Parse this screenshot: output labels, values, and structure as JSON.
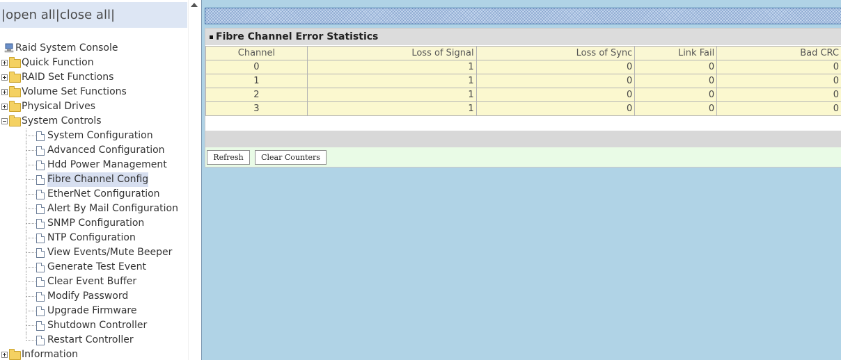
{
  "nav": {
    "open_all": "open all",
    "close_all": "close all",
    "root_label": "Raid System Console",
    "folders": [
      {
        "label": "Quick Function"
      },
      {
        "label": "RAID Set Functions"
      },
      {
        "label": "Volume Set Functions"
      },
      {
        "label": "Physical Drives"
      },
      {
        "label": "System Controls"
      }
    ],
    "system_controls_items": [
      {
        "label": "System Configuration"
      },
      {
        "label": "Advanced Configuration"
      },
      {
        "label": "Hdd Power Management"
      },
      {
        "label": "Fibre Channel Config"
      },
      {
        "label": "EtherNet Configuration"
      },
      {
        "label": "Alert By Mail Configuration"
      },
      {
        "label": "SNMP Configuration"
      },
      {
        "label": "NTP Configuration"
      },
      {
        "label": "View Events/Mute Beeper"
      },
      {
        "label": "Generate Test Event"
      },
      {
        "label": "Clear Event Buffer"
      },
      {
        "label": "Modify Password"
      },
      {
        "label": "Upgrade Firmware"
      },
      {
        "label": "Shutdown Controller"
      },
      {
        "label": "Restart Controller"
      }
    ],
    "information_label": "Information",
    "selected_item": "Fibre Channel Config"
  },
  "panel": {
    "title": "Fibre Channel Error Statistics",
    "columns": [
      "Channel",
      "Loss of Signal",
      "Loss of Sync",
      "Link Fail",
      "Bad CRC"
    ],
    "rows": [
      [
        "0",
        "1",
        "0",
        "0",
        "0"
      ],
      [
        "1",
        "1",
        "0",
        "0",
        "0"
      ],
      [
        "2",
        "1",
        "0",
        "0",
        "0"
      ],
      [
        "3",
        "1",
        "0",
        "0",
        "0"
      ]
    ],
    "buttons": {
      "refresh": "Refresh",
      "clear_counters": "Clear Counters"
    }
  },
  "colors": {
    "right_background": "#b0d3e6",
    "table_cell": "#fbf8cf",
    "button_bar": "#e9fbe6"
  }
}
